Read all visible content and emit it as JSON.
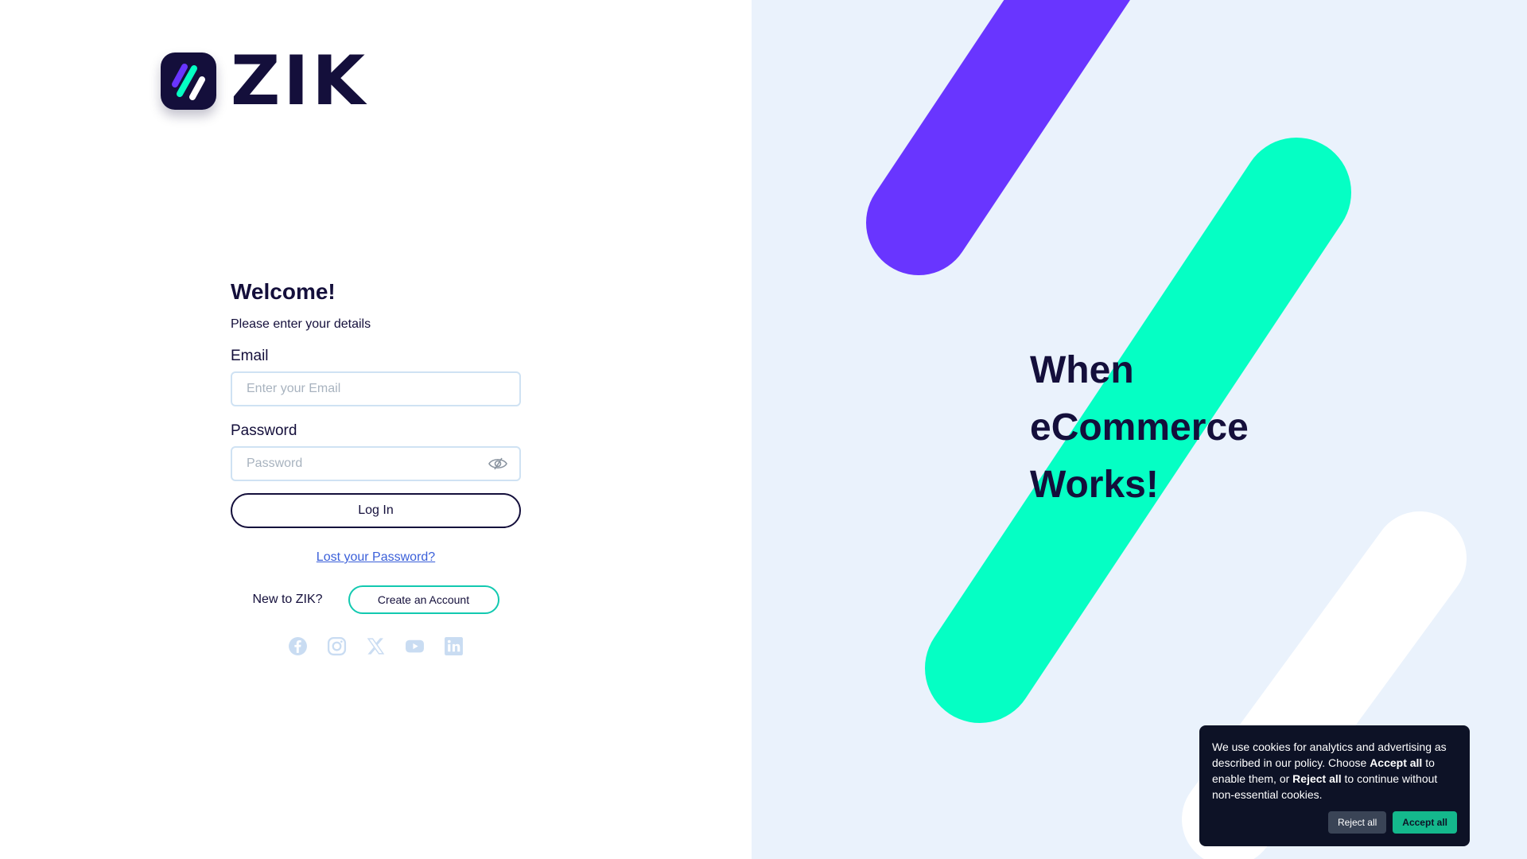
{
  "brand": {
    "name": "ZIK",
    "colors": {
      "navy": "#140f3b",
      "purple": "#6935ff",
      "mint": "#05ffc4",
      "panel_bg": "#eaf2fc"
    }
  },
  "login": {
    "welcome": "Welcome!",
    "subtitle": "Please enter your details",
    "email_label": "Email",
    "email_placeholder": "Enter your Email",
    "email_value": "",
    "password_label": "Password",
    "password_placeholder": "Password",
    "password_value": "",
    "show_password_icon": "eye-off-icon",
    "login_button": "Log In",
    "lost_password_link": "Lost your Password?",
    "new_user_text": "New to ZIK?",
    "create_account_button": "Create an Account"
  },
  "social": [
    {
      "icon": "facebook-icon"
    },
    {
      "icon": "instagram-icon"
    },
    {
      "icon": "x-icon"
    },
    {
      "icon": "youtube-icon"
    },
    {
      "icon": "linkedin-icon"
    }
  ],
  "hero": {
    "line1": "When",
    "line2": "eCommerce",
    "line3": "Works!"
  },
  "cookie": {
    "text_part1": "We use cookies for analytics and advertising as described in our policy. Choose ",
    "accept_bold": "Accept all",
    "text_part2": " to enable them, or ",
    "reject_bold": "Reject all",
    "text_part3": " to continue without non-essential cookies.",
    "reject_button": "Reject all",
    "accept_button": "Accept all"
  }
}
